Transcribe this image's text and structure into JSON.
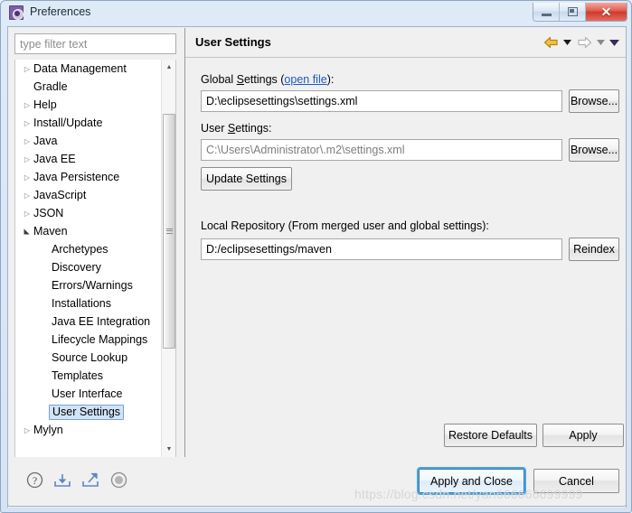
{
  "window": {
    "title": "Preferences",
    "icon": "preferences-gear-icon",
    "buttons": {
      "minimize": "minimize-icon",
      "maximize": "maximize-icon",
      "close": "✕"
    }
  },
  "sidebar": {
    "filter": {
      "placeholder": "type filter text",
      "value": ""
    },
    "tree": [
      {
        "label": "Data Management",
        "expandable": true,
        "expanded": false,
        "child": false
      },
      {
        "label": "Gradle",
        "expandable": false,
        "expanded": false,
        "child": false
      },
      {
        "label": "Help",
        "expandable": true,
        "expanded": false,
        "child": false
      },
      {
        "label": "Install/Update",
        "expandable": true,
        "expanded": false,
        "child": false
      },
      {
        "label": "Java",
        "expandable": true,
        "expanded": false,
        "child": false
      },
      {
        "label": "Java EE",
        "expandable": true,
        "expanded": false,
        "child": false
      },
      {
        "label": "Java Persistence",
        "expandable": true,
        "expanded": false,
        "child": false
      },
      {
        "label": "JavaScript",
        "expandable": true,
        "expanded": false,
        "child": false
      },
      {
        "label": "JSON",
        "expandable": true,
        "expanded": false,
        "child": false
      },
      {
        "label": "Maven",
        "expandable": true,
        "expanded": true,
        "child": false
      },
      {
        "label": "Archetypes",
        "child": true
      },
      {
        "label": "Discovery",
        "child": true
      },
      {
        "label": "Errors/Warnings",
        "child": true
      },
      {
        "label": "Installations",
        "child": true
      },
      {
        "label": "Java EE Integration",
        "child": true
      },
      {
        "label": "Lifecycle Mappings",
        "child": true
      },
      {
        "label": "Source Lookup",
        "child": true
      },
      {
        "label": "Templates",
        "child": true
      },
      {
        "label": "User Interface",
        "child": true
      },
      {
        "label": "User Settings",
        "child": true,
        "selected": true
      },
      {
        "label": "Mylyn",
        "expandable": true,
        "expanded": false,
        "child": false
      }
    ]
  },
  "page": {
    "title": "User Settings",
    "nav": {
      "back_icon": "back-arrow-icon",
      "back_menu_icon": "chevron-down-icon",
      "forward_icon": "forward-arrow-icon",
      "forward_menu_icon": "chevron-down-icon",
      "view_menu_icon": "chevron-down-icon"
    },
    "global_settings": {
      "label_prefix": "Global ",
      "label_underlined": "S",
      "label_suffix": "ettings (",
      "link_text": "open file",
      "label_end": "):",
      "value": "D:\\eclipsesettings\\settings.xml",
      "browse_label": "Browse..."
    },
    "user_settings": {
      "label_prefix": "User ",
      "label_underlined": "S",
      "label_suffix": "ettings:",
      "value": "C:\\Users\\Administrator\\.m2\\settings.xml",
      "disabled": true,
      "browse_label": "Browse..."
    },
    "update_settings_label": "Update Settings",
    "local_repository": {
      "label": "Local Repository (From merged user and global settings):",
      "value": "D:/eclipsesettings/maven",
      "reindex_label": "Reindex"
    },
    "restore_defaults_label": "Restore Defaults",
    "apply_label": "Apply"
  },
  "footer": {
    "icons": [
      {
        "name": "help-icon",
        "glyph": "?"
      },
      {
        "name": "import-icon",
        "glyph": "import"
      },
      {
        "name": "export-icon",
        "glyph": "export"
      },
      {
        "name": "record-icon",
        "glyph": "record"
      }
    ],
    "apply_and_close_label": "Apply and Close",
    "cancel_label": "Cancel"
  },
  "watermark": "https://blog.csdn.net/yan666666699999",
  "colors": {
    "accent_blue": "#4aa3e0",
    "link": "#1b58c4",
    "selection": "#cfe4f7",
    "title_icon": "#7b5ea7",
    "close_red": "#cc3a2c",
    "back_arrow": "#d9a428"
  }
}
